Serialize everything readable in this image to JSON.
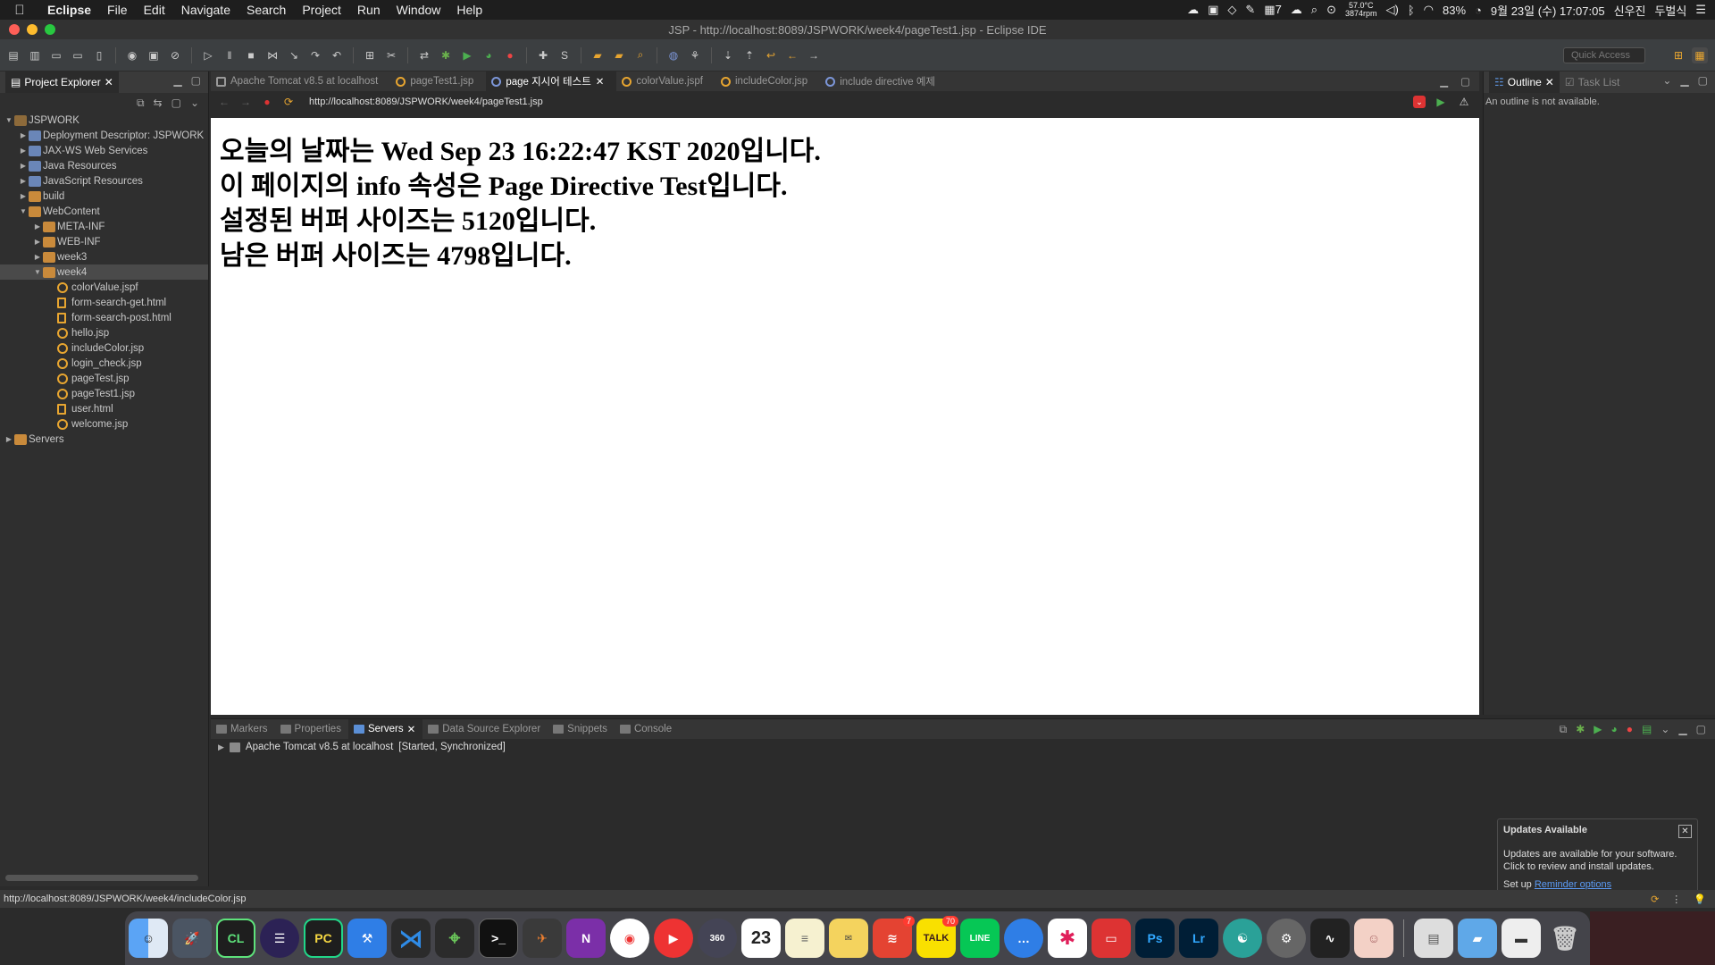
{
  "menubar": {
    "app_name": "Eclipse",
    "items": [
      "File",
      "Edit",
      "Navigate",
      "Search",
      "Project",
      "Run",
      "Window",
      "Help"
    ],
    "status": {
      "temp_line1": "57.0°C",
      "temp_line2": "3874rpm",
      "calendar_badge": "7",
      "battery": "83%",
      "date_time": "9월 23일 (수) 17:07:05",
      "user": "신우진",
      "input_method": "두벌식"
    }
  },
  "window": {
    "title": "JSP - http://localhost:8089/JSPWORK/week4/pageTest1.jsp - Eclipse IDE"
  },
  "toolbar": {
    "quick_access_placeholder": "Quick Access"
  },
  "explorer": {
    "tab_label": "Project Explorer",
    "tree": [
      {
        "label": "JSPWORK",
        "depth": 0,
        "expanded": true,
        "icon": "project-icon"
      },
      {
        "label": "Deployment Descriptor: JSPWORK",
        "depth": 1,
        "expanded": false,
        "icon": "deployment-descriptor-icon"
      },
      {
        "label": "JAX-WS Web Services",
        "depth": 1,
        "expanded": false,
        "icon": "web-services-icon"
      },
      {
        "label": "Java Resources",
        "depth": 1,
        "expanded": false,
        "icon": "java-resources-icon"
      },
      {
        "label": "JavaScript Resources",
        "depth": 1,
        "expanded": false,
        "icon": "javascript-resources-icon"
      },
      {
        "label": "build",
        "depth": 1,
        "expanded": false,
        "icon": "folder-icon"
      },
      {
        "label": "WebContent",
        "depth": 1,
        "expanded": true,
        "icon": "folder-icon"
      },
      {
        "label": "META-INF",
        "depth": 2,
        "expanded": false,
        "icon": "folder-icon"
      },
      {
        "label": "WEB-INF",
        "depth": 2,
        "expanded": false,
        "icon": "folder-icon"
      },
      {
        "label": "week3",
        "depth": 2,
        "expanded": false,
        "icon": "folder-icon"
      },
      {
        "label": "week4",
        "depth": 2,
        "expanded": true,
        "icon": "folder-icon",
        "selected": true
      },
      {
        "label": "colorValue.jspf",
        "depth": 3,
        "icon": "jsp-file-icon"
      },
      {
        "label": "form-search-get.html",
        "depth": 3,
        "icon": "html-file-icon"
      },
      {
        "label": "form-search-post.html",
        "depth": 3,
        "icon": "html-file-icon"
      },
      {
        "label": "hello.jsp",
        "depth": 3,
        "icon": "jsp-file-icon"
      },
      {
        "label": "includeColor.jsp",
        "depth": 3,
        "icon": "jsp-file-icon"
      },
      {
        "label": "login_check.jsp",
        "depth": 3,
        "icon": "jsp-file-icon"
      },
      {
        "label": "pageTest.jsp",
        "depth": 3,
        "icon": "jsp-file-icon"
      },
      {
        "label": "pageTest1.jsp",
        "depth": 3,
        "icon": "jsp-file-icon"
      },
      {
        "label": "user.html",
        "depth": 3,
        "icon": "html-file-icon"
      },
      {
        "label": "welcome.jsp",
        "depth": 3,
        "icon": "jsp-file-icon"
      },
      {
        "label": "Servers",
        "depth": 0,
        "expanded": false,
        "icon": "folder-icon"
      }
    ]
  },
  "editor": {
    "tabs": [
      {
        "label": "Apache Tomcat v8.5 at localhost",
        "icon": "tomcat",
        "active": false
      },
      {
        "label": "pageTest1.jsp",
        "icon": "jsp",
        "active": false
      },
      {
        "label": "page 지시어 테스트",
        "icon": "globe",
        "active": true,
        "closable": true
      },
      {
        "label": "colorValue.jspf",
        "icon": "jsp",
        "active": false
      },
      {
        "label": "includeColor.jsp",
        "icon": "jsp",
        "active": false
      },
      {
        "label": "include directive 예제",
        "icon": "globe",
        "active": false
      }
    ],
    "url": "http://localhost:8089/JSPWORK/week4/pageTest1.jsp",
    "page_lines": [
      "오늘의 날짜는 Wed Sep 23 16:22:47 KST 2020입니다.",
      "이 페이지의 info 속성은 Page Directive Test입니다.",
      "설정된 버퍼 사이즈는 5120입니다.",
      "남은 버퍼 사이즈는 4798입니다."
    ]
  },
  "outline": {
    "tab_label": "Outline",
    "second_tab_label": "Task List",
    "message": "An outline is not available."
  },
  "bottom_panel": {
    "tabs": [
      {
        "label": "Markers",
        "active": false
      },
      {
        "label": "Properties",
        "active": false
      },
      {
        "label": "Servers",
        "active": true
      },
      {
        "label": "Data Source Explorer",
        "active": false
      },
      {
        "label": "Snippets",
        "active": false
      },
      {
        "label": "Console",
        "active": false
      }
    ],
    "server_name": "Apache Tomcat v8.5 at localhost",
    "server_state": "[Started, Synchronized]"
  },
  "update_popup": {
    "title": "Updates Available",
    "body_line1": "Updates are available for your software.",
    "body_line2": "Click to review and install updates.",
    "setup_prefix": "Set up ",
    "link_label": "Reminder options"
  },
  "statusbar": {
    "text": "http://localhost:8089/JSPWORK/week4/includeColor.jsp"
  },
  "dock": {
    "calendar_date": "23",
    "todoist_badge": "7",
    "kakaotalk_badge": "70",
    "kakaotalk_label": "TALK",
    "line_label": "LINE"
  },
  "colors": {
    "accent": "#5b8fd6",
    "jsp_icon": "#e7a530",
    "folder": "#c98a3b",
    "link": "#5b9bf5"
  }
}
